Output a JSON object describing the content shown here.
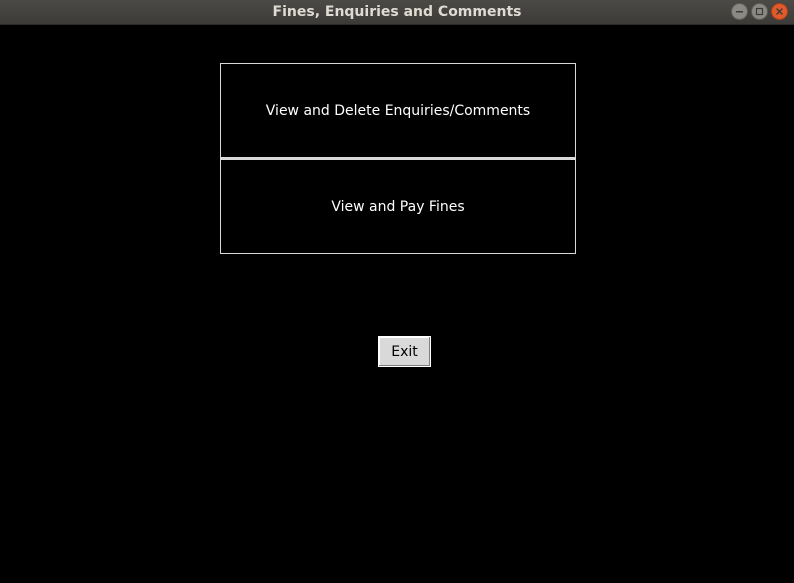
{
  "window": {
    "title": "Fines, Enquiries and Comments",
    "controls": {
      "minimize_icon": "minimize-icon",
      "maximize_icon": "maximize-icon",
      "close_icon": "close-icon"
    }
  },
  "menu": {
    "enquiries_label": "View and Delete Enquiries/Comments",
    "fines_label": "View and Pay Fines"
  },
  "exit_label": "Exit",
  "colors": {
    "background": "#000000",
    "titlebar": "#3c3b37",
    "close_button": "#e05a2b",
    "button_border": "#d9d9d9",
    "exit_button_bg": "#d9d9d9"
  }
}
